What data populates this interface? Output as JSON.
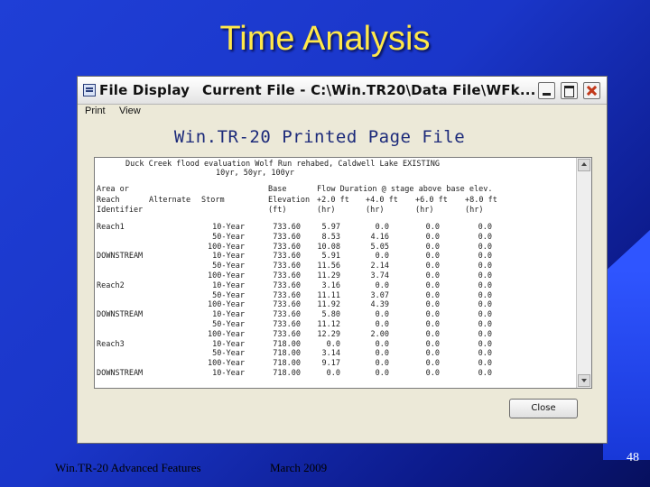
{
  "slide": {
    "title": "Time Analysis",
    "footer_left": "Win.TR-20 Advanced Features",
    "footer_center": "March 2009",
    "page_number": "48"
  },
  "window": {
    "title": "File Display",
    "current_file": "Current File - C:\\Win.TR20\\Data File\\WFk...",
    "menu": [
      "Print",
      "View"
    ],
    "heading": "Win.TR-20 Printed Page File",
    "close_button": "Close"
  },
  "report": {
    "title_line1": "Duck Creek flood evaluation Wolf Run rehabed, Caldwell Lake EXISTING",
    "title_line2": "10yr, 50yr, 100yr",
    "column_headers": [
      [
        "Area or",
        "",
        "",
        "Base",
        "Flow Duration @ stage above base elev.",
        "",
        "",
        ""
      ],
      [
        "Reach",
        "Alternate",
        "Storm",
        "Elevation",
        "+2.0 ft",
        "+4.0 ft",
        "+6.0 ft",
        "+8.0 ft"
      ],
      [
        "Identifier",
        "",
        "",
        "(ft)",
        "(hr)",
        "(hr)",
        "(hr)",
        "(hr)"
      ]
    ],
    "rows": [
      [
        "Reach1",
        "10-Year",
        "733.60",
        "5.97",
        "0.0",
        "0.0",
        "0.0"
      ],
      [
        "",
        "50-Year",
        "733.60",
        "8.53",
        "4.16",
        "0.0",
        "0.0"
      ],
      [
        "",
        "100-Year",
        "733.60",
        "10.08",
        "5.05",
        "0.0",
        "0.0"
      ],
      [
        "DOWNSTREAM",
        "10-Year",
        "733.60",
        "5.91",
        "0.0",
        "0.0",
        "0.0"
      ],
      [
        "",
        "50-Year",
        "733.60",
        "11.56",
        "2.14",
        "0.0",
        "0.0"
      ],
      [
        "",
        "100-Year",
        "733.60",
        "11.29",
        "3.74",
        "0.0",
        "0.0"
      ],
      [
        "Reach2",
        "10-Year",
        "733.60",
        "3.16",
        "0.0",
        "0.0",
        "0.0"
      ],
      [
        "",
        "50-Year",
        "733.60",
        "11.11",
        "3.07",
        "0.0",
        "0.0"
      ],
      [
        "",
        "100-Year",
        "733.60",
        "11.92",
        "4.39",
        "0.0",
        "0.0"
      ],
      [
        "DOWNSTREAM",
        "10-Year",
        "733.60",
        "5.80",
        "0.0",
        "0.0",
        "0.0"
      ],
      [
        "",
        "50-Year",
        "733.60",
        "11.12",
        "0.0",
        "0.0",
        "0.0"
      ],
      [
        "",
        "100-Year",
        "733.60",
        "12.29",
        "2.00",
        "0.0",
        "0.0"
      ],
      [
        "Reach3",
        "10-Year",
        "718.00",
        "0.0",
        "0.0",
        "0.0",
        "0.0"
      ],
      [
        "",
        "50-Year",
        "718.00",
        "3.14",
        "0.0",
        "0.0",
        "0.0"
      ],
      [
        "",
        "100-Year",
        "718.00",
        "9.17",
        "0.0",
        "0.0",
        "0.0"
      ],
      [
        "DOWNSTREAM",
        "10-Year",
        "718.00",
        "0.0",
        "0.0",
        "0.0",
        "0.0"
      ]
    ]
  }
}
